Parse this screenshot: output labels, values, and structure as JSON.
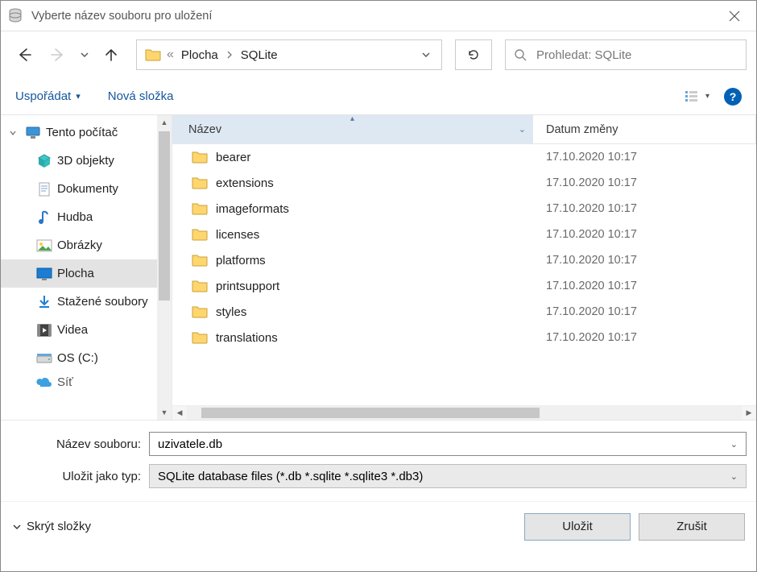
{
  "title": "Vyberte název souboru pro uložení",
  "breadcrumb": {
    "prefix": "«",
    "items": [
      "Plocha",
      "SQLite"
    ]
  },
  "search": {
    "placeholder": "Prohledat: SQLite"
  },
  "toolbar": {
    "organize": "Uspořádat",
    "new_folder": "Nová složka"
  },
  "columns": {
    "name": "Název",
    "date": "Datum změny"
  },
  "tree": {
    "root": "Tento počítač",
    "items": [
      {
        "label": "3D objekty",
        "icon": "cube"
      },
      {
        "label": "Dokumenty",
        "icon": "doc"
      },
      {
        "label": "Hudba",
        "icon": "music"
      },
      {
        "label": "Obrázky",
        "icon": "pic"
      },
      {
        "label": "Plocha",
        "icon": "desktop",
        "selected": true
      },
      {
        "label": "Stažené soubory",
        "icon": "download"
      },
      {
        "label": "Videa",
        "icon": "video"
      },
      {
        "label": "OS (C:)",
        "icon": "drive"
      }
    ],
    "cutoff": "Síť"
  },
  "files": [
    {
      "name": "bearer",
      "date": "17.10.2020 10:17"
    },
    {
      "name": "extensions",
      "date": "17.10.2020 10:17"
    },
    {
      "name": "imageformats",
      "date": "17.10.2020 10:17"
    },
    {
      "name": "licenses",
      "date": "17.10.2020 10:17"
    },
    {
      "name": "platforms",
      "date": "17.10.2020 10:17"
    },
    {
      "name": "printsupport",
      "date": "17.10.2020 10:17"
    },
    {
      "name": "styles",
      "date": "17.10.2020 10:17"
    },
    {
      "name": "translations",
      "date": "17.10.2020 10:17"
    }
  ],
  "form": {
    "name_label": "Název souboru:",
    "name_value": "uzivatele.db",
    "type_label": "Uložit jako typ:",
    "type_value": "SQLite database files (*.db *.sqlite *.sqlite3 *.db3)"
  },
  "footer": {
    "hide_folders": "Skrýt složky",
    "save": "Uložit",
    "cancel": "Zrušit"
  }
}
